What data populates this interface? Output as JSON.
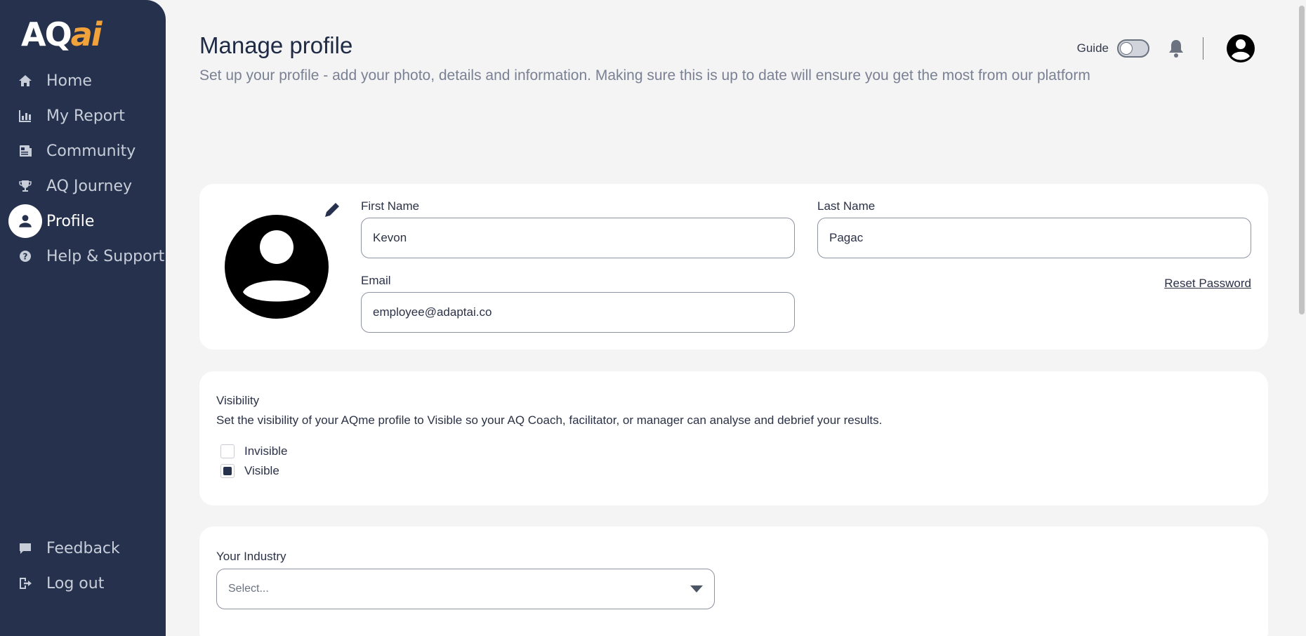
{
  "app": {
    "logo_part1": "AQ",
    "logo_part2": "ai",
    "brand_color": "#26324d",
    "accent_color": "#f2a23a"
  },
  "sidebar": {
    "items": [
      {
        "label": "Home",
        "icon": "home-icon"
      },
      {
        "label": "My Report",
        "icon": "bar-chart-icon"
      },
      {
        "label": "Community",
        "icon": "newspaper-icon"
      },
      {
        "label": "AQ Journey",
        "icon": "trophy-icon"
      },
      {
        "label": "Profile",
        "icon": "user-icon",
        "active": true
      },
      {
        "label": "Help & Support",
        "icon": "help-icon"
      }
    ],
    "bottom_items": [
      {
        "label": "Feedback",
        "icon": "comment-icon"
      },
      {
        "label": "Log out",
        "icon": "logout-icon"
      }
    ]
  },
  "header": {
    "title": "Manage profile",
    "subtitle": "Set up your profile - add your photo, details and information. Making sure this is up to date will ensure you get the most from our platform",
    "guide_label": "Guide",
    "guide_enabled": false
  },
  "profile": {
    "first_name_label": "First Name",
    "first_name_value": "Kevon",
    "last_name_label": "Last Name",
    "last_name_value": "Pagac",
    "email_label": "Email",
    "email_value": "employee@adaptai.co",
    "reset_password": "Reset Password"
  },
  "visibility": {
    "title": "Visibility",
    "description": "Set the visibility of your AQme profile to Visible so your AQ Coach, facilitator, or manager can analyse and debrief your results.",
    "options": [
      {
        "label": "Invisible",
        "checked": false
      },
      {
        "label": "Visible",
        "checked": true
      }
    ]
  },
  "industry": {
    "label": "Your Industry",
    "placeholder": "Select..."
  }
}
